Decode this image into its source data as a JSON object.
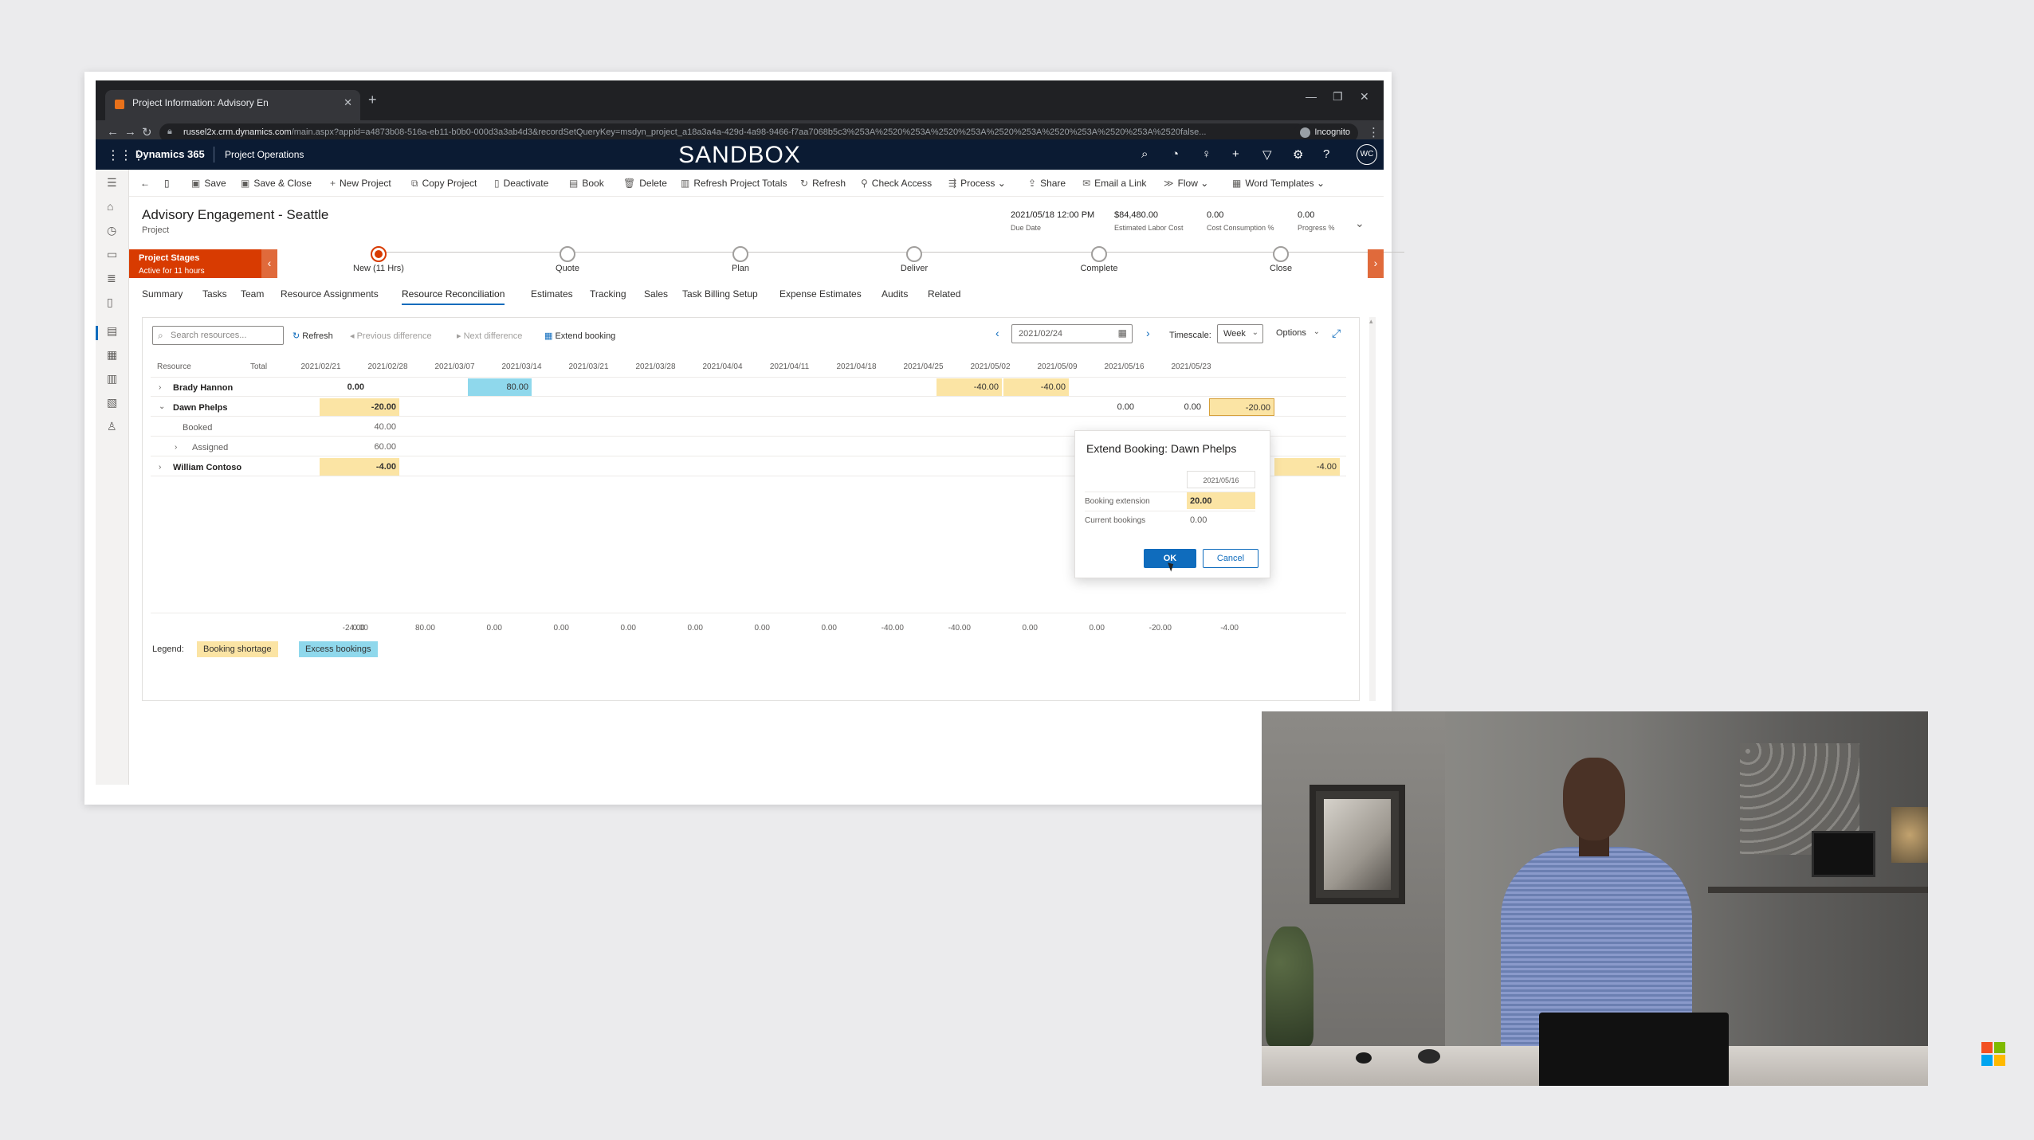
{
  "browser": {
    "tab_title": "Project Information: Advisory En",
    "url_host": "russel2x.crm.dynamics.com",
    "url_path": "/main.aspx?appid=a4873b08-516a-eb11-b0b0-000d3a3ab4d3&recordSetQueryKey=msdyn_project_a18a3a4a-429d-4a98-9466-f7aa7068b5c3%253A%2520%253A%2520%253A%2520%253A%2520%253A%2520%253A%2520false...",
    "incognito_label": "Incognito"
  },
  "app": {
    "brand": "Dynamics 365",
    "app_name": "Project Operations",
    "environment": "SANDBOX",
    "avatar_initials": "WC"
  },
  "commands": [
    {
      "icon": "save-icon",
      "label": "Save"
    },
    {
      "icon": "save-close-icon",
      "label": "Save & Close"
    },
    {
      "icon": "plus-icon",
      "label": "New Project"
    },
    {
      "icon": "copy-icon",
      "label": "Copy Project"
    },
    {
      "icon": "deactivate-icon",
      "label": "Deactivate"
    },
    {
      "icon": "book-icon",
      "label": "Book"
    },
    {
      "icon": "delete-icon",
      "label": "Delete"
    },
    {
      "icon": "refresh-totals-icon",
      "label": "Refresh Project Totals"
    },
    {
      "icon": "refresh-icon",
      "label": "Refresh"
    },
    {
      "icon": "check-access-icon",
      "label": "Check Access"
    },
    {
      "icon": "process-icon",
      "label": "Process"
    },
    {
      "icon": "share-icon",
      "label": "Share"
    },
    {
      "icon": "email-link-icon",
      "label": "Email a Link"
    },
    {
      "icon": "flow-icon",
      "label": "Flow"
    },
    {
      "icon": "word-templates-icon",
      "label": "Word Templates"
    }
  ],
  "record": {
    "title": "Advisory Engagement - Seattle",
    "entity": "Project",
    "fields": [
      {
        "value": "2021/05/18 12:00 PM",
        "label": "Due Date"
      },
      {
        "value": "$84,480.00",
        "label": "Estimated Labor Cost"
      },
      {
        "value": "0.00",
        "label": "Cost Consumption %"
      },
      {
        "value": "0.00",
        "label": "Progress %"
      }
    ]
  },
  "bpf": {
    "active_title": "Project Stages",
    "active_sub": "Active for 11 hours",
    "stages": [
      "New  (11 Hrs)",
      "Quote",
      "Plan",
      "Deliver",
      "Complete",
      "Close"
    ],
    "current_index": 0
  },
  "tabs": [
    "Summary",
    "Tasks",
    "Team",
    "Resource Assignments",
    "Resource Reconciliation",
    "Estimates",
    "Tracking",
    "Sales",
    "Task Billing Setup",
    "Expense Estimates",
    "Audits",
    "Related"
  ],
  "active_tab": "Resource Reconciliation",
  "recon": {
    "search_placeholder": "Search resources...",
    "refresh": "Refresh",
    "prev_diff": "Previous difference",
    "next_diff": "Next difference",
    "extend": "Extend booking",
    "date": "2021/02/24",
    "timescale_label": "Timescale:",
    "timescale_value": "Week",
    "options": "Options",
    "col_resource": "Resource",
    "col_total": "Total",
    "weeks": [
      "2021/02/21",
      "2021/02/28",
      "2021/03/07",
      "2021/03/14",
      "2021/03/21",
      "2021/03/28",
      "2021/04/04",
      "2021/04/11",
      "2021/04/18",
      "2021/04/25",
      "2021/05/02",
      "2021/05/09",
      "2021/05/16",
      "2021/05/23"
    ],
    "rows": [
      {
        "name": "Brady Hannon",
        "total": "0.00"
      },
      {
        "name": "Dawn Phelps",
        "total": "-20.00"
      },
      {
        "name": "Booked",
        "total": "40.00"
      },
      {
        "name": "Assigned",
        "total": "60.00"
      },
      {
        "name": "William Contoso",
        "total": "-4.00"
      }
    ],
    "cells": {
      "brady_0228": "80.00",
      "brady_0418": "-40.00",
      "brady_0425": "-40.00",
      "dawn_0502": "0.00",
      "dawn_0509": "0.00",
      "dawn_0516": "-20.00",
      "william_0523": "-4.00"
    },
    "totals": {
      "grand": "-24.00",
      "weeks": [
        "0.00",
        "80.00",
        "0.00",
        "0.00",
        "0.00",
        "0.00",
        "0.00",
        "0.00",
        "-40.00",
        "-40.00",
        "0.00",
        "0.00",
        "-20.00",
        "-4.00"
      ]
    },
    "legend_label": "Legend:",
    "legend_shortage": "Booking shortage",
    "legend_excess": "Excess bookings"
  },
  "dialog": {
    "title": "Extend Booking: Dawn Phelps",
    "date": "2021/05/16",
    "ext_label": "Booking extension",
    "ext_value": "20.00",
    "cur_label": "Current bookings",
    "cur_value": "0.00",
    "ok": "OK",
    "cancel": "Cancel"
  },
  "colors": {
    "shortage": "#fbe4a4",
    "excess": "#8fd8ec",
    "bpf_active": "#d83b01",
    "primary": "#0f6cbd",
    "topbar": "#0b1b33"
  }
}
